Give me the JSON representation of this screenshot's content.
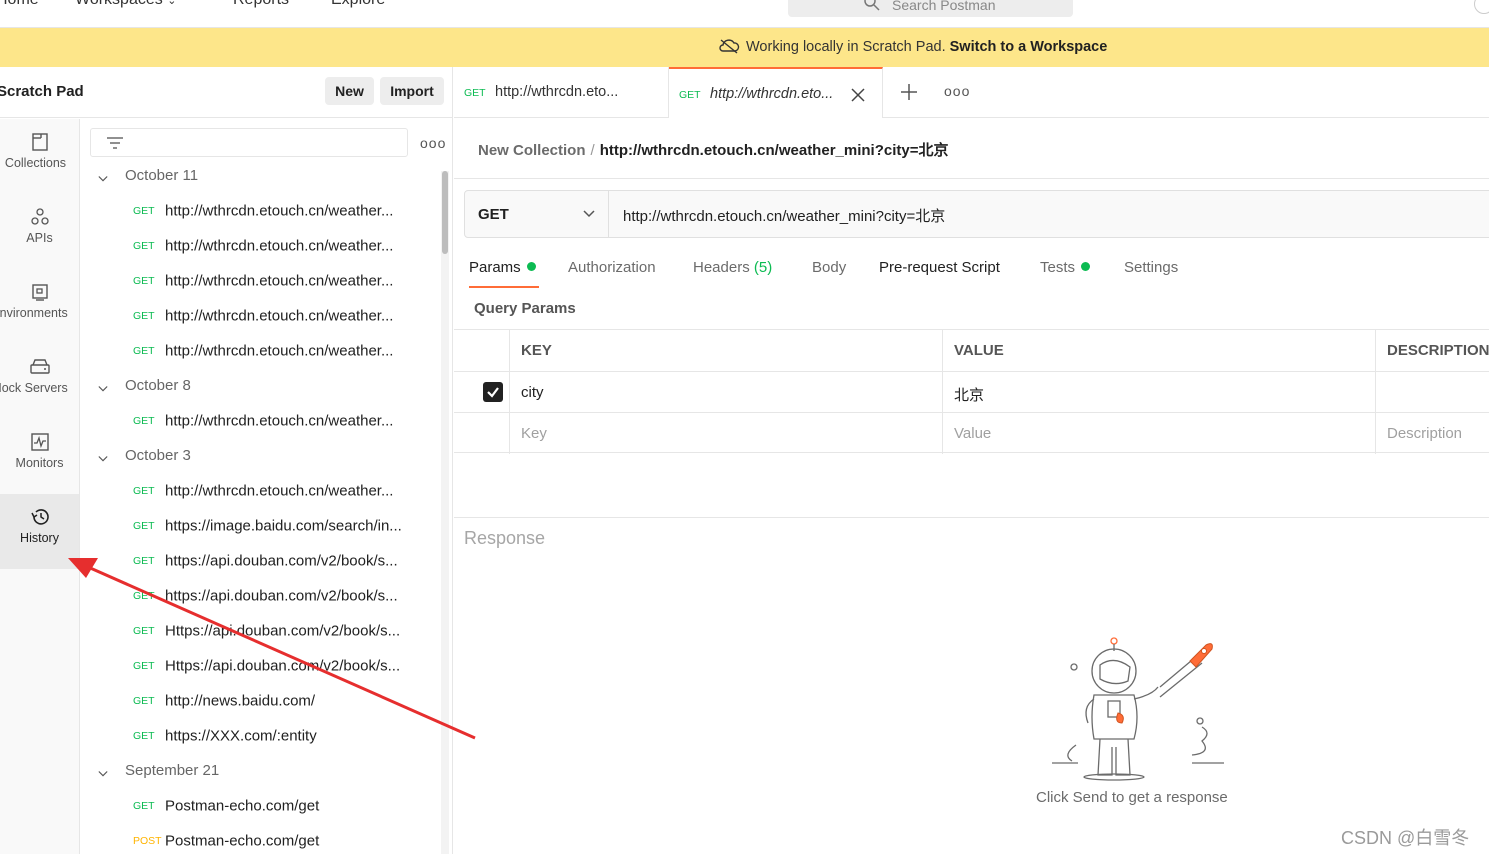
{
  "topnav": {
    "home": "Home",
    "workspaces": "Workspaces",
    "reports": "Reports",
    "explore": "Explore",
    "search_placeholder": "Search Postman"
  },
  "banner": {
    "text": "Working locally in Scratch Pad.",
    "link": "Switch to a Workspace"
  },
  "sidebar": {
    "title": "Scratch Pad",
    "new_label": "New",
    "import_label": "Import",
    "rail": [
      {
        "label": "Collections",
        "icon": "collections-icon"
      },
      {
        "label": "APIs",
        "icon": "apis-icon"
      },
      {
        "label": "Environments",
        "icon": "environments-icon"
      },
      {
        "label": "Mock Servers",
        "icon": "mock-servers-icon"
      },
      {
        "label": "Monitors",
        "icon": "monitors-icon"
      },
      {
        "label": "History",
        "icon": "history-icon"
      }
    ],
    "groups": [
      {
        "label": "October 11",
        "items": [
          {
            "method": "GET",
            "url": "http://wthrcdn.etouch.cn/weather..."
          },
          {
            "method": "GET",
            "url": "http://wthrcdn.etouch.cn/weather..."
          },
          {
            "method": "GET",
            "url": "http://wthrcdn.etouch.cn/weather..."
          },
          {
            "method": "GET",
            "url": "http://wthrcdn.etouch.cn/weather..."
          },
          {
            "method": "GET",
            "url": "http://wthrcdn.etouch.cn/weather..."
          }
        ]
      },
      {
        "label": "October 8",
        "items": [
          {
            "method": "GET",
            "url": "http://wthrcdn.etouch.cn/weather..."
          }
        ]
      },
      {
        "label": "October 3",
        "items": [
          {
            "method": "GET",
            "url": "http://wthrcdn.etouch.cn/weather..."
          },
          {
            "method": "GET",
            "url": "https://image.baidu.com/search/in..."
          },
          {
            "method": "GET",
            "url": "https://api.douban.com/v2/book/s..."
          },
          {
            "method": "GET",
            "url": "https://api.douban.com/v2/book/s..."
          },
          {
            "method": "GET",
            "url": "Https://api.douban.com/v2/book/s..."
          },
          {
            "method": "GET",
            "url": "Https://api.douban.com/v2/book/s..."
          },
          {
            "method": "GET",
            "url": "http://news.baidu.com/"
          },
          {
            "method": "GET",
            "url": "https://XXX.com/:entity"
          }
        ]
      },
      {
        "label": "September 21",
        "items": [
          {
            "method": "GET",
            "url": "Postman-echo.com/get"
          },
          {
            "method": "POST",
            "url": "Postman-echo.com/get"
          }
        ]
      }
    ]
  },
  "tabs": [
    {
      "method": "GET",
      "label": "http://wthrcdn.eto..."
    },
    {
      "method": "GET",
      "label": "http://wthrcdn.eto..."
    }
  ],
  "breadcrumb": {
    "collection": "New Collection",
    "sep": "/",
    "request": "http://wthrcdn.etouch.cn/weather_mini?city=北京"
  },
  "request": {
    "method": "GET",
    "url": "http://wthrcdn.etouch.cn/weather_mini?city=北京"
  },
  "reqtabs": {
    "params": "Params",
    "authorization": "Authorization",
    "headers": "Headers",
    "headers_count": "(5)",
    "body": "Body",
    "prerequest": "Pre-request Script",
    "tests": "Tests",
    "settings": "Settings"
  },
  "params": {
    "title": "Query Params",
    "headers": [
      "KEY",
      "VALUE",
      "DESCRIPTION"
    ],
    "rows": [
      {
        "key": "city",
        "value": "北京",
        "description": "",
        "checked": true
      }
    ],
    "placeholders": {
      "key": "Key",
      "value": "Value",
      "description": "Description"
    }
  },
  "response": {
    "title": "Response",
    "empty_text": "Click Send to get a response"
  },
  "watermark": "CSDN @白雪冬",
  "colors": {
    "accent": "#ff6c37",
    "get": "#0cbb52",
    "post": "#ffb400",
    "banner": "#fde68a"
  }
}
